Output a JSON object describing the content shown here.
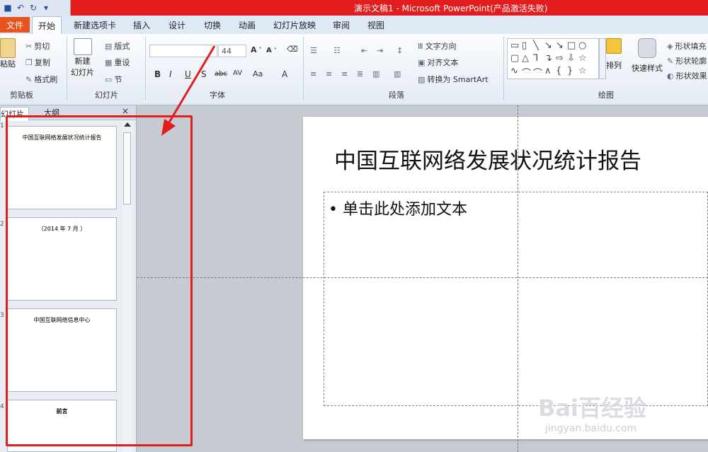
{
  "titlebar": {
    "title": "演示文稿1 - Microsoft PowerPoint(产品激活失败)"
  },
  "tabs": {
    "file": "文件",
    "items": [
      "开始",
      "新建选项卡",
      "插入",
      "设计",
      "切换",
      "动画",
      "幻灯片放映",
      "审阅",
      "视图"
    ]
  },
  "ribbon": {
    "clipboard": {
      "paste": "粘贴",
      "cut": "剪切",
      "copy": "复制",
      "format_painter": "格式刷",
      "label": "剪贴板"
    },
    "slides": {
      "new_slide": "新建",
      "new_slide2": "幻灯片",
      "layout": "版式",
      "reset": "重设",
      "section": "节",
      "label": "幻灯片"
    },
    "font": {
      "size": "44",
      "label": "字体"
    },
    "paragraph": {
      "text_direction": "文字方向",
      "align_text": "对齐文本",
      "smartart": "转换为 SmartArt",
      "label": "段落"
    },
    "drawing": {
      "arrange": "排列",
      "quick_styles": "快速样式",
      "fill": "形状填充",
      "outline": "形状轮廓",
      "effects": "形状效果",
      "label": "绘图"
    }
  },
  "panel": {
    "tab_slides": "幻灯片",
    "tab_outline": "大纲",
    "close": "×",
    "thumbs": [
      {
        "num": "1",
        "text": "中国互联网络发展状况统计报告"
      },
      {
        "num": "2",
        "text": "（2014 年 7 月 ）"
      },
      {
        "num": "3",
        "text": "中国互联网络信息中心"
      },
      {
        "num": "4",
        "text": "前言"
      }
    ]
  },
  "slide": {
    "title": "中国互联网络发展状况统计报告",
    "bullet": "单击此处添加文本"
  },
  "watermark": {
    "brand": "Bai百经验",
    "url": "jingyan.baidu.com"
  },
  "colors": {
    "annotation": "#e01e1e",
    "file_tab": "#e8531f",
    "titlebar": "#e31d1d"
  }
}
